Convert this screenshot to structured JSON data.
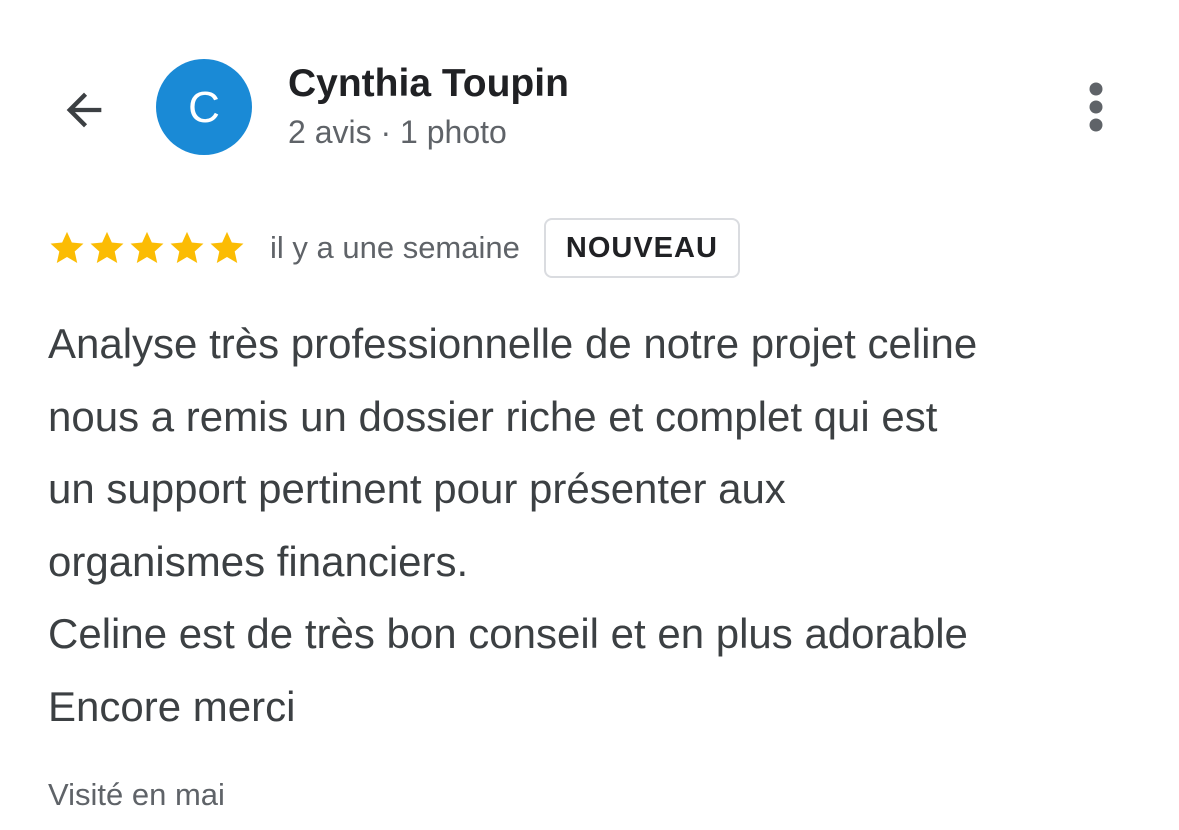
{
  "reviewer": {
    "name": "Cynthia Toupin",
    "avatar_initial": "C",
    "avatar_color": "#1a8ad6",
    "meta": "2 avis · 1 photo"
  },
  "review": {
    "rating": 5,
    "rating_max": 5,
    "star_color": "#fbbc04",
    "time_ago": "il y a une semaine",
    "badge": "NOUVEAU",
    "lines": [
      "Analyse très professionnelle de notre projet celine",
      "nous a remis un dossier riche et complet qui est",
      "un support pertinent pour présenter aux",
      "organismes financiers.",
      "Celine est de très bon conseil et en plus adorable",
      "Encore merci"
    ],
    "visited": "Visité en mai"
  },
  "icons": {
    "back": "arrow-back-icon",
    "more": "more-vert-icon",
    "star": "star-icon"
  }
}
